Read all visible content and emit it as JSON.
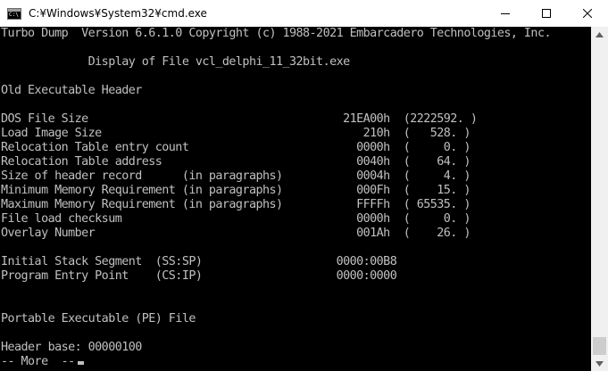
{
  "window": {
    "title": "C:¥Windows¥System32¥cmd.exe",
    "icon": "cmd-console-icon",
    "icon_text": "C:\\",
    "controls": [
      "minimize-icon",
      "maximize-icon",
      "close-icon"
    ]
  },
  "console": {
    "lines": [
      "Turbo Dump  Version 6.6.1.0 Copyright (c) 1988-2021 Embarcadero Technologies, Inc.",
      "",
      "             Display of File vcl_delphi_11_32bit.exe",
      "",
      "Old Executable Header",
      "",
      "DOS File Size                                      21EA00h  (2222592. )",
      "Load Image Size                                       210h  (   528. )",
      "Relocation Table entry count                         0000h  (     0. )",
      "Relocation Table address                             0040h  (    64. )",
      "Size of header record      (in paragraphs)           0004h  (     4. )",
      "Minimum Memory Requirement (in paragraphs)           000Fh  (    15. )",
      "Maximum Memory Requirement (in paragraphs)           FFFFh  ( 65535. )",
      "File load checksum                                   0000h  (     0. )",
      "Overlay Number                                       001Ah  (    26. )",
      "",
      "Initial Stack Segment  (SS:SP)                    0000:00B8",
      "Program Entry Point    (CS:IP)                    0000:0000",
      "",
      "",
      "Portable Executable (PE) File",
      "",
      "Header base: 00000100",
      "-- More  --"
    ]
  },
  "colors": {
    "console_bg": "#000000",
    "console_fg": "#c0c0c0",
    "titlebar_bg": "#ffffff",
    "scrollbar_bg": "#f0f0f0",
    "scroll_thumb": "#cdcdcd"
  }
}
